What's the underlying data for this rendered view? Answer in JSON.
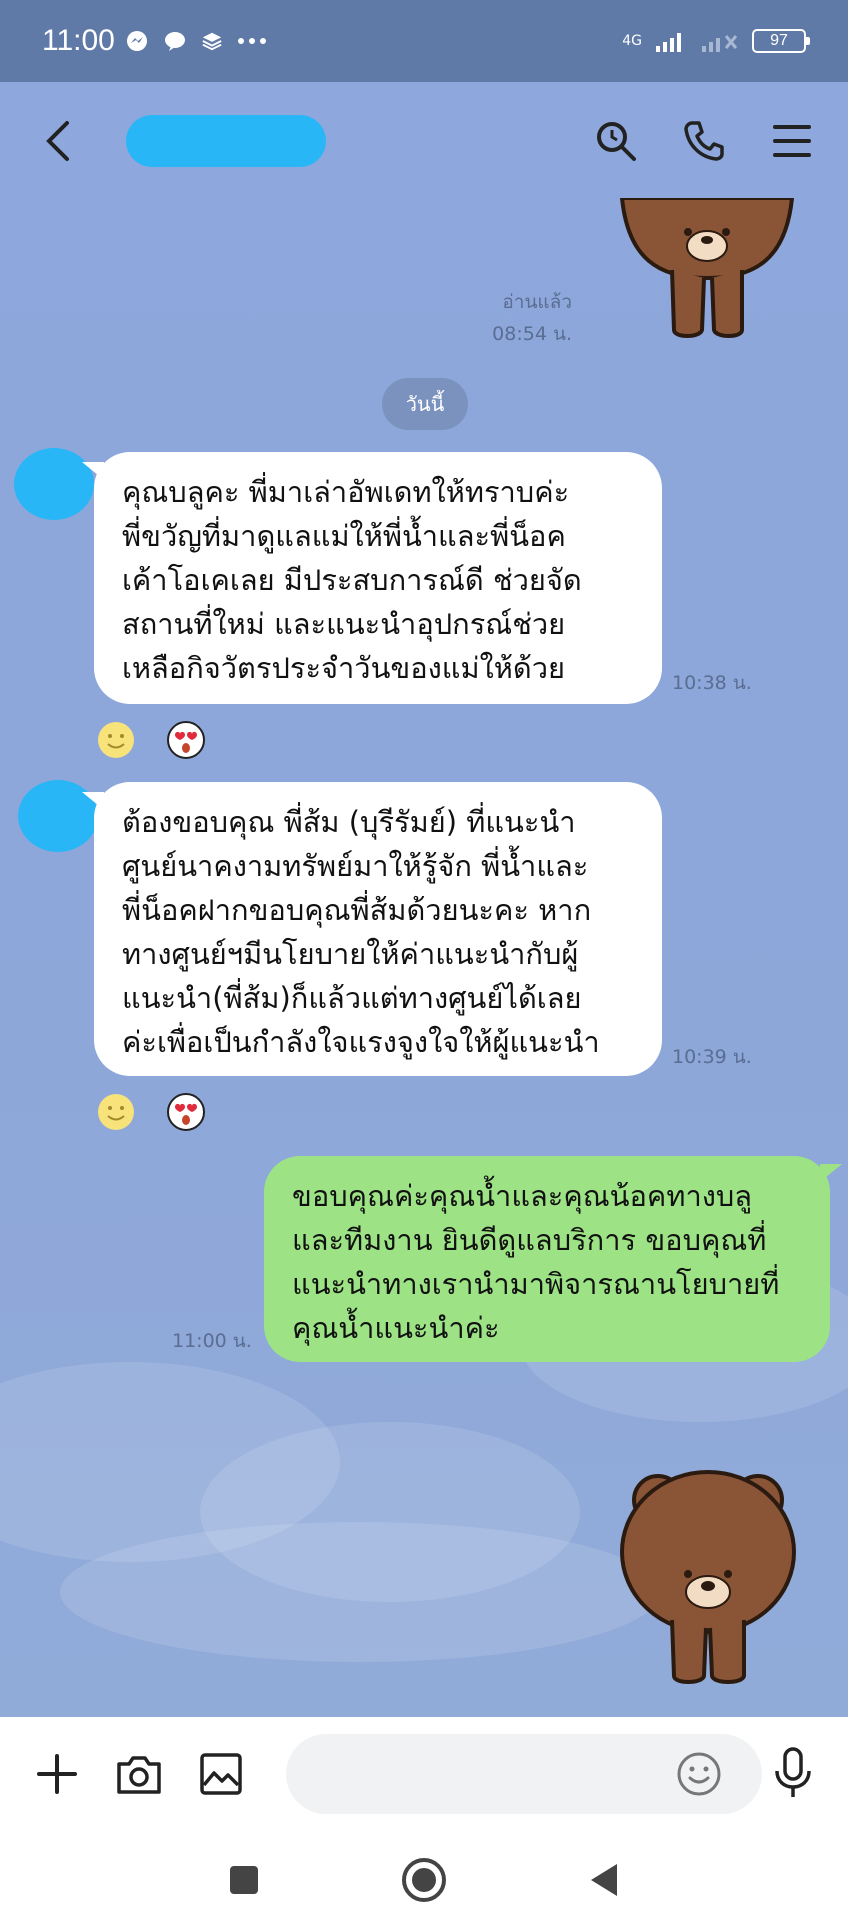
{
  "status_bar": {
    "time": "11:00",
    "network": "4G",
    "battery": "97"
  },
  "header": {
    "contact_name": ""
  },
  "chat": {
    "read_receipt": "อ่านแล้ว",
    "read_time": "08:54 น.",
    "date_separator": "วันนี้",
    "messages": [
      {
        "direction": "incoming",
        "text": "คุณบลูคะ พี่มาเล่าอัพเดทให้ทราบค่ะ\nพี่ขวัญที่มาดูแลแม่ให้พี่น้ำและพี่น็อค\nเค้าโอเคเลย มีประสบการณ์ดี ช่วยจัด\nสถานที่ใหม่ และแนะนำอุปกรณ์ช่วย\nเหลือกิจวัตรประจำวันของแม่ให้ด้วย",
        "time": "10:38 น."
      },
      {
        "direction": "incoming",
        "text": "ต้องขอบคุณ พี่ส้ม (บุรีรัมย์) ที่แนะนำ\nศูนย์นาคงามทรัพย์มาให้รู้จัก พี่น้ำและ\nพี่น็อคฝากขอบคุณพี่ส้มด้วยนะคะ หาก\nทางศูนย์ฯมีนโยบายให้ค่าแนะนำกับผู้\nแนะนำ(พี่ส้ม)ก็แล้วแต่ทางศูนย์ได้เลย\nค่ะเพื่อเป็นกำลังใจแรงจูงใจให้ผู้แนะนำ",
        "time": "10:39 น."
      },
      {
        "direction": "outgoing",
        "text": "ขอบคุณค่ะคุณน้ำและคุณน้อคทางบลู\nและทีมงาน ยินดีดูแลบริการ ขอบคุณที่\nแนะนำทางเรานำมาพิจารณานโยบายที่\nคุณน้ำแนะนำค่ะ",
        "time": "11:00 น."
      }
    ]
  },
  "input": {
    "placeholder": ""
  },
  "icons": {
    "back": "chevron-left-icon",
    "search": "search-icon",
    "call": "phone-icon",
    "menu": "hamburger-menu-icon",
    "add": "plus-icon",
    "camera": "camera-icon",
    "gallery": "image-icon",
    "emoji": "emoji-icon",
    "mic": "microphone-icon"
  },
  "colors": {
    "chat_background": "#8ea7dc",
    "incoming_bubble": "#ffffff",
    "outgoing_bubble": "#9de386",
    "status_bar": "#5f7aa6"
  }
}
